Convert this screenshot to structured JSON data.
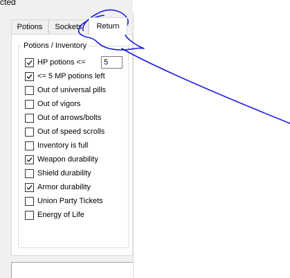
{
  "window": {
    "caption_fragment": "cted"
  },
  "tabs": [
    {
      "label": "Potions",
      "active": false
    },
    {
      "label": "Sockets",
      "active": false
    },
    {
      "label": "Return",
      "active": true
    }
  ],
  "group": {
    "title": "Potions / Inventory"
  },
  "hp_threshold": {
    "value": "5"
  },
  "options": [
    {
      "label": "HP potions  <=",
      "checked": true
    },
    {
      "label": "<= 5 MP potions left",
      "checked": true
    },
    {
      "label": "Out of universal pills",
      "checked": false
    },
    {
      "label": "Out of vigors",
      "checked": false
    },
    {
      "label": "Out of arrows/bolts",
      "checked": false
    },
    {
      "label": "Out of speed scrolls",
      "checked": false
    },
    {
      "label": "Inventory is full",
      "checked": false
    },
    {
      "label": "Weapon durability",
      "checked": true
    },
    {
      "label": "Shield durability",
      "checked": false
    },
    {
      "label": "Armor durability",
      "checked": true
    },
    {
      "label": "Union Party Tickets",
      "checked": false
    },
    {
      "label": "Energy of Life",
      "checked": false
    }
  ],
  "annotation": {
    "color": "#1a1adc"
  }
}
